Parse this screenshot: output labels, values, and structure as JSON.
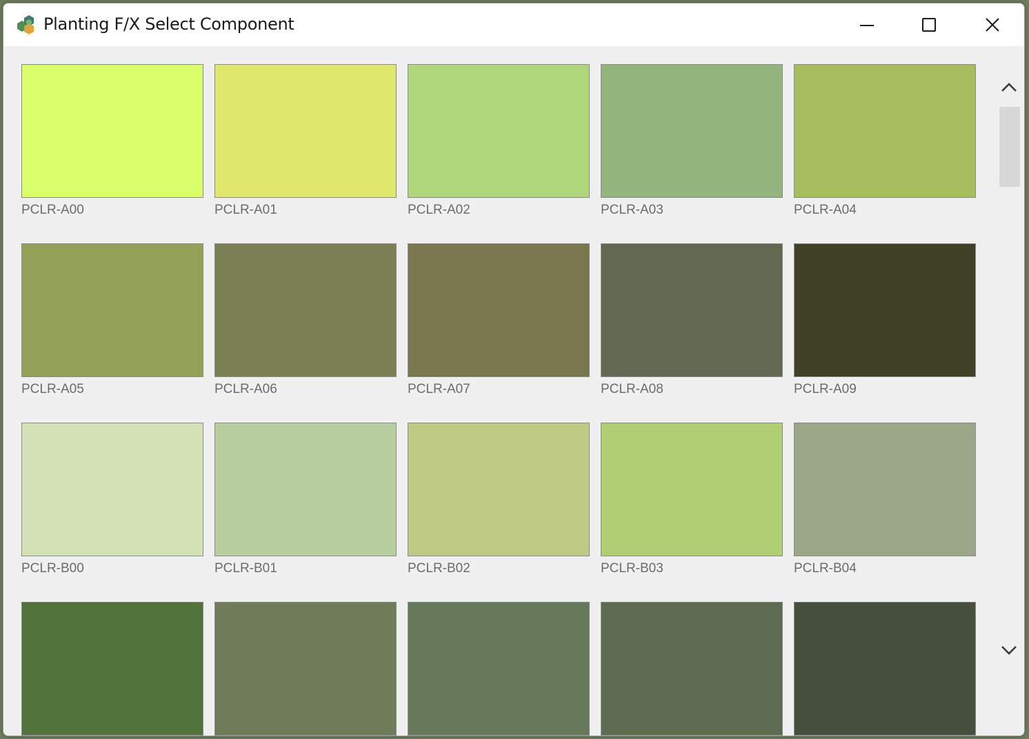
{
  "window": {
    "title": "Planting F/X Select Component"
  },
  "controls": {
    "minimize_icon": "minimize-icon",
    "maximize_icon": "maximize-icon",
    "close_icon": "close-icon"
  },
  "swatches": [
    {
      "label": "PCLR-A00",
      "color": "#daff6a"
    },
    {
      "label": "PCLR-A01",
      "color": "#dfe86c"
    },
    {
      "label": "PCLR-A02",
      "color": "#afd67b"
    },
    {
      "label": "PCLR-A03",
      "color": "#93b47c"
    },
    {
      "label": "PCLR-A04",
      "color": "#a8bd5d"
    },
    {
      "label": "PCLR-A05",
      "color": "#91a257"
    },
    {
      "label": "PCLR-A06",
      "color": "#7a8053"
    },
    {
      "label": "PCLR-A07",
      "color": "#7a764d"
    },
    {
      "label": "PCLR-A08",
      "color": "#636851"
    },
    {
      "label": "PCLR-A09",
      "color": "#3e4123"
    },
    {
      "label": "PCLR-B00",
      "color": "#d3e1b5"
    },
    {
      "label": "PCLR-B01",
      "color": "#b8cd9e"
    },
    {
      "label": "PCLR-B02",
      "color": "#bfca85"
    },
    {
      "label": "PCLR-B03",
      "color": "#b0cf73"
    },
    {
      "label": "PCLR-B04",
      "color": "#9aa685"
    },
    {
      "label": "",
      "color": "#52743c"
    },
    {
      "label": "",
      "color": "#707c59"
    },
    {
      "label": "",
      "color": "#677759"
    },
    {
      "label": "",
      "color": "#5d6b51"
    },
    {
      "label": "",
      "color": "#46503c"
    }
  ]
}
